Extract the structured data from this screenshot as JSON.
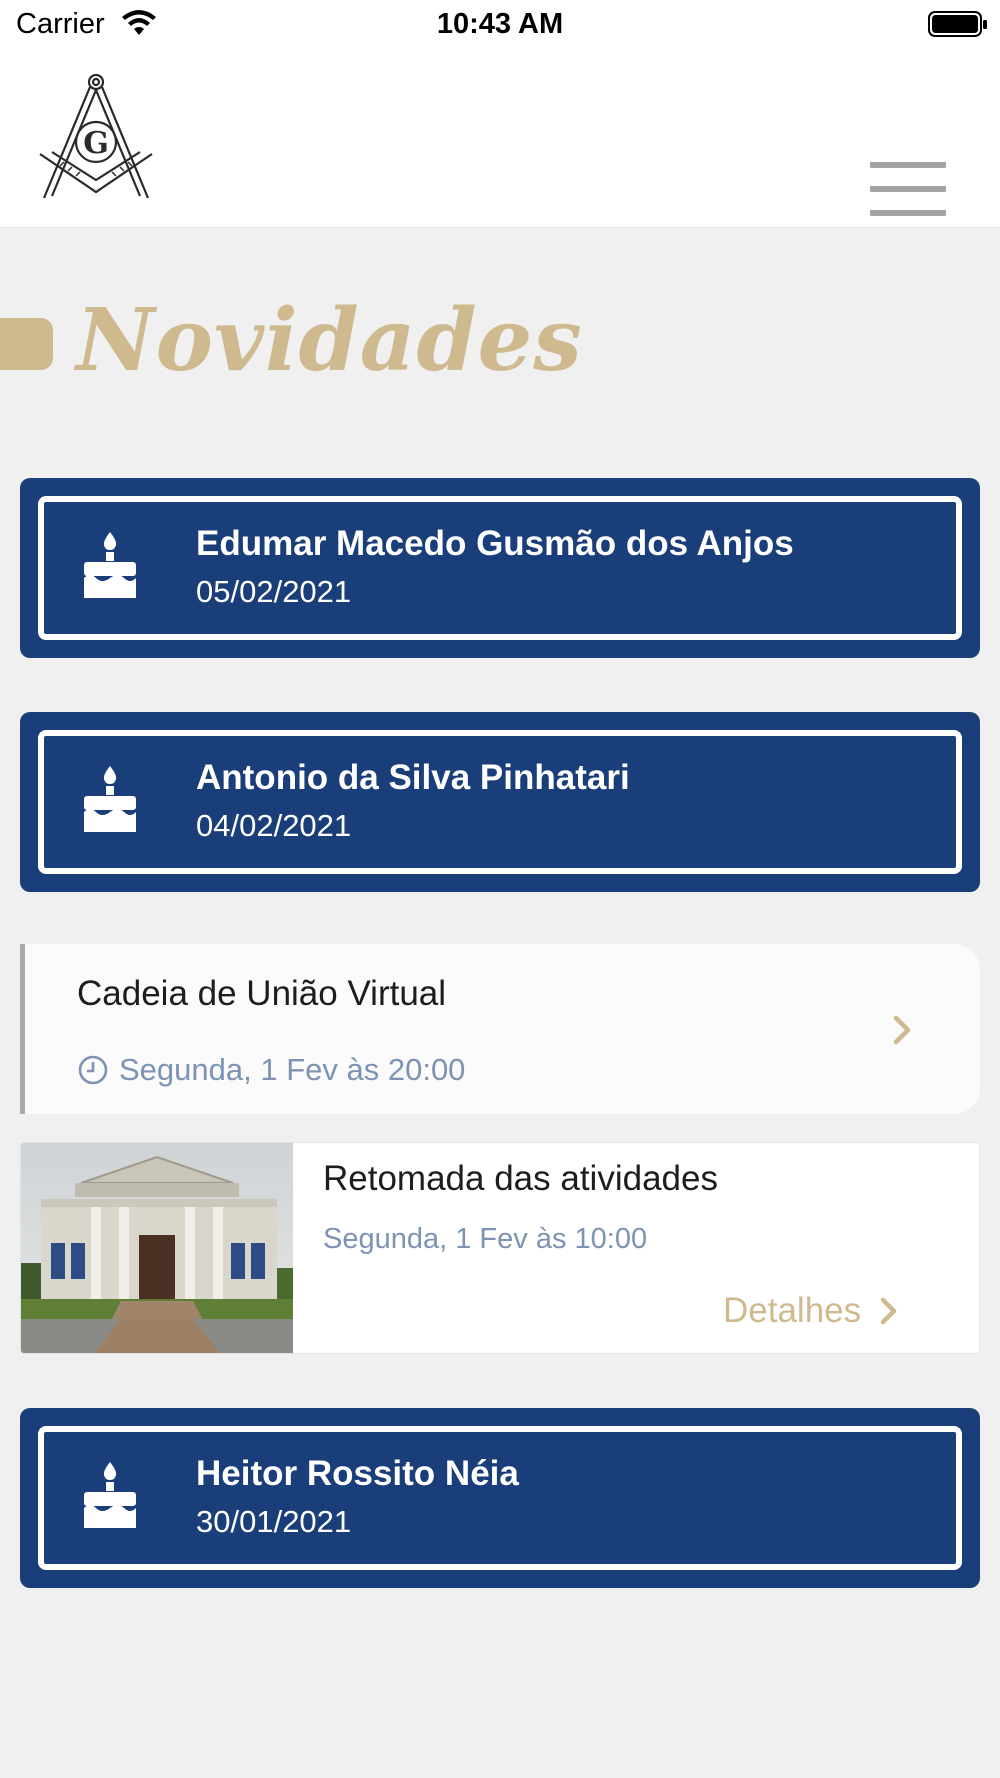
{
  "status_bar": {
    "carrier": "Carrier",
    "time": "10:43 AM"
  },
  "header": {
    "logo_icon": "square-and-compasses-icon",
    "menu_icon": "hamburger-menu-icon"
  },
  "page": {
    "title": "Novidades"
  },
  "birthdays": [
    {
      "name": "Edumar Macedo Gusmão dos Anjos",
      "date": "05/02/2021",
      "icon": "birthday-cake-icon"
    },
    {
      "name": "Antonio da Silva Pinhatari",
      "date": "04/02/2021",
      "icon": "birthday-cake-icon"
    },
    {
      "name": "Heitor Rossito Néia",
      "date": "30/01/2021",
      "icon": "birthday-cake-icon"
    }
  ],
  "event": {
    "title": "Cadeia de União Virtual",
    "datetime": "Segunda, 1 Fev às 20:00",
    "icon": "clock-icon"
  },
  "news": {
    "title": "Retomada das atividades",
    "datetime": "Segunda, 1 Fev às 10:00",
    "details_label": "Detalhes",
    "image": "temple-building-photo"
  },
  "colors": {
    "navy": "#1a3e79",
    "gold": "#cfba90",
    "muted_blue": "#7e93b4",
    "background": "#f0f0f0"
  }
}
